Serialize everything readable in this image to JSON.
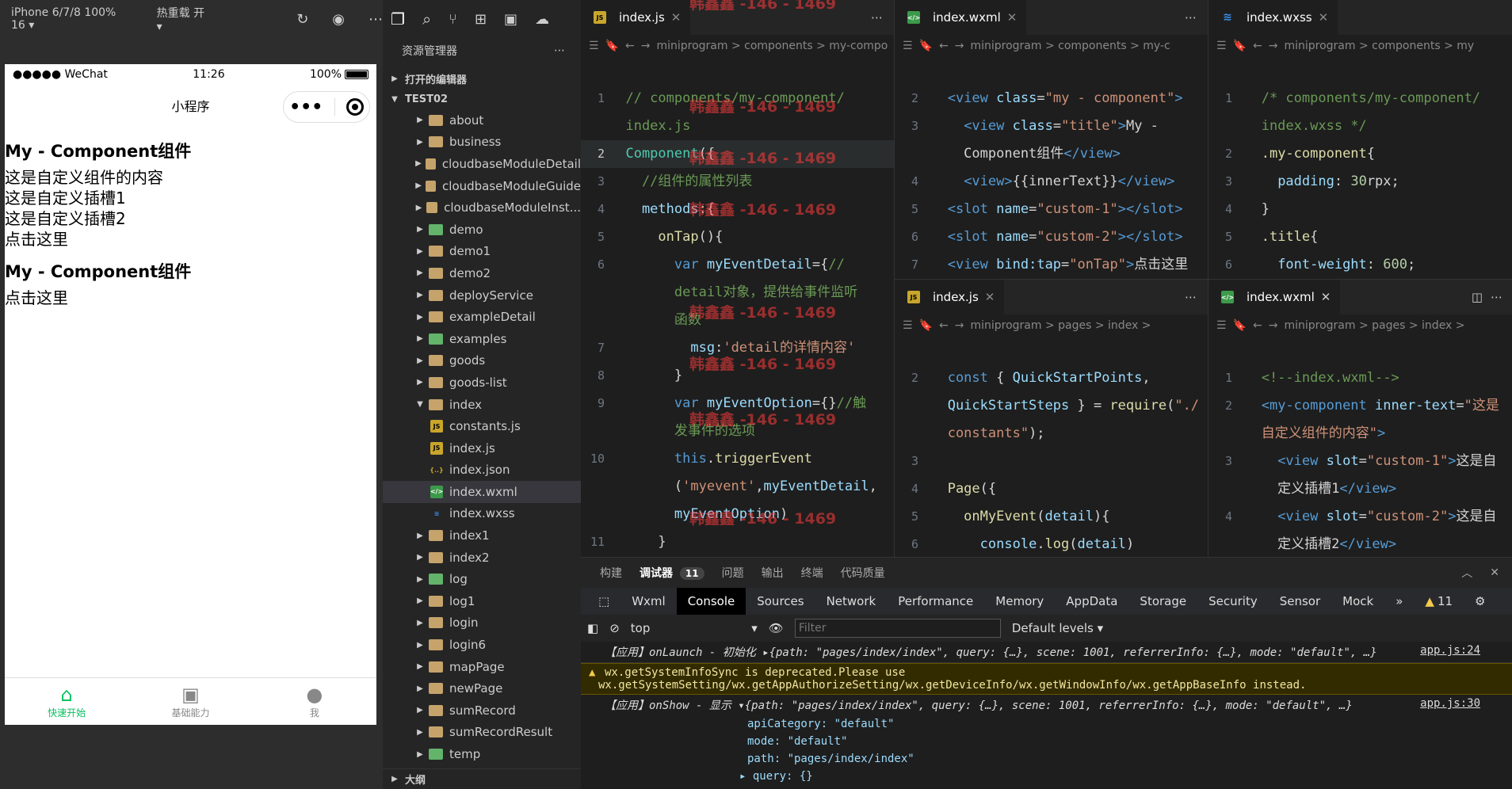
{
  "simulator": {
    "device": "iPhone 6/7/8 100% 16",
    "hot_reload": "热重载 开",
    "status": {
      "carrier": "●●●●● WeChat",
      "time": "11:26",
      "battery": "100%"
    },
    "nav_title": "小程序",
    "content": [
      {
        "type": "h",
        "text": "My - Component组件"
      },
      {
        "type": "p",
        "text": "这是自定义组件的内容"
      },
      {
        "type": "p",
        "text": "这是自定义插槽1"
      },
      {
        "type": "p",
        "text": "这是自定义插槽2"
      },
      {
        "type": "p",
        "text": "点击这里"
      },
      {
        "type": "h",
        "text": "My - Component组件"
      },
      {
        "type": "p",
        "text": "点击这里"
      }
    ],
    "tabbar": [
      {
        "label": "快速开始",
        "icon": "home-icon",
        "active": true
      },
      {
        "label": "基础能力",
        "icon": "terminal-icon",
        "active": false
      },
      {
        "label": "我",
        "icon": "user-icon",
        "active": false
      }
    ]
  },
  "explorer": {
    "title": "资源管理器",
    "open_editors": "打开的编辑器",
    "project": "TEST02",
    "outline": "大纲",
    "items": [
      {
        "name": "about",
        "type": "folder",
        "indent": 1
      },
      {
        "name": "business",
        "type": "folder",
        "indent": 1
      },
      {
        "name": "cloudbaseModuleDetail",
        "type": "folder",
        "indent": 1
      },
      {
        "name": "cloudbaseModuleGuide",
        "type": "folder",
        "indent": 1
      },
      {
        "name": "cloudbaseModuleInst...",
        "type": "folder",
        "indent": 1
      },
      {
        "name": "demo",
        "type": "folder-special",
        "indent": 1
      },
      {
        "name": "demo1",
        "type": "folder",
        "indent": 1
      },
      {
        "name": "demo2",
        "type": "folder",
        "indent": 1
      },
      {
        "name": "deployService",
        "type": "folder",
        "indent": 1
      },
      {
        "name": "exampleDetail",
        "type": "folder",
        "indent": 1
      },
      {
        "name": "examples",
        "type": "folder-special",
        "indent": 1
      },
      {
        "name": "goods",
        "type": "folder",
        "indent": 1
      },
      {
        "name": "goods-list",
        "type": "folder",
        "indent": 1
      },
      {
        "name": "index",
        "type": "folder-open",
        "indent": 1
      },
      {
        "name": "constants.js",
        "type": "js",
        "indent": 2
      },
      {
        "name": "index.js",
        "type": "js",
        "indent": 2
      },
      {
        "name": "index.json",
        "type": "json",
        "indent": 2
      },
      {
        "name": "index.wxml",
        "type": "wxml",
        "indent": 2,
        "selected": true
      },
      {
        "name": "index.wxss",
        "type": "wxss",
        "indent": 2
      },
      {
        "name": "index1",
        "type": "folder",
        "indent": 1
      },
      {
        "name": "index2",
        "type": "folder",
        "indent": 1
      },
      {
        "name": "log",
        "type": "folder-special",
        "indent": 1
      },
      {
        "name": "log1",
        "type": "folder",
        "indent": 1
      },
      {
        "name": "login",
        "type": "folder",
        "indent": 1
      },
      {
        "name": "login6",
        "type": "folder",
        "indent": 1
      },
      {
        "name": "mapPage",
        "type": "folder",
        "indent": 1
      },
      {
        "name": "newPage",
        "type": "folder",
        "indent": 1
      },
      {
        "name": "sumRecord",
        "type": "folder",
        "indent": 1
      },
      {
        "name": "sumRecordResult",
        "type": "folder",
        "indent": 1
      },
      {
        "name": "temp",
        "type": "folder-special",
        "indent": 1
      }
    ]
  },
  "editors": {
    "e1": {
      "tab": "index.js",
      "crumb": "miniprogram > components > my-compo"
    },
    "e2": {
      "tab": "index.wxml",
      "crumb": "miniprogram > components > my-c"
    },
    "e3": {
      "tab": "index.wxss",
      "crumb": "miniprogram > components > my"
    },
    "e4": {
      "tab": "index.js",
      "crumb": "miniprogram > pages > index >"
    },
    "e5": {
      "tab": "index.wxml",
      "crumb": "miniprogram > pages > index >"
    }
  },
  "watermark": "韩鑫鑫 -146 - 1469",
  "panel": {
    "tabs": [
      "构建",
      "调试器",
      "11",
      "问题",
      "输出",
      "终端",
      "代码质量"
    ],
    "devtools": [
      "Wxml",
      "Console",
      "Sources",
      "Network",
      "Performance",
      "Memory",
      "AppData",
      "Storage",
      "Security",
      "Sensor",
      "Mock"
    ],
    "warn_count": "11",
    "context": "top",
    "filter_placeholder": "Filter",
    "levels": "Default levels",
    "logs": {
      "l1": "【应用】onLaunch - 初始化 ▸{path: \"pages/index/index\", query: {…}, scene: 1001, referrerInfo: {…}, mode: \"default\", …}",
      "l1src": "app.js:24",
      "w1": "wx.getSystemInfoSync is deprecated.Please use",
      "w2": "wx.getSystemSetting/wx.getAppAuthorizeSetting/wx.getDeviceInfo/wx.getWindowInfo/wx.getAppBaseInfo instead.",
      "l2": "【应用】onShow - 显示 ▾{path: \"pages/index/index\", query: {…}, scene: 1001, referrerInfo: {…}, mode: \"default\", …}",
      "l2src": "app.js:30",
      "d1": "apiCategory: \"default\"",
      "d2": "mode: \"default\"",
      "d3": "path: \"pages/index/index\"",
      "d4": "▸ query: {}"
    }
  }
}
